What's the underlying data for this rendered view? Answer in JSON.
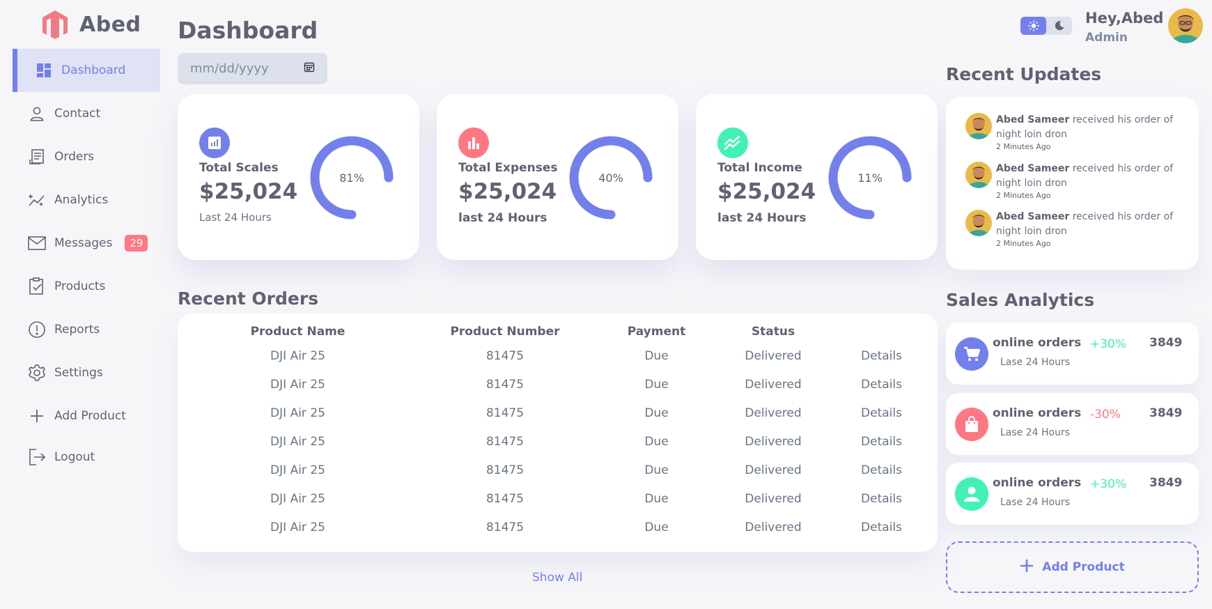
{
  "brand": {
    "name": "Abed"
  },
  "sidebar": {
    "items": [
      {
        "label": "Dashboard"
      },
      {
        "label": "Contact"
      },
      {
        "label": "Orders"
      },
      {
        "label": "Analytics"
      },
      {
        "label": "Messages",
        "badge": "29"
      },
      {
        "label": "Products"
      },
      {
        "label": "Reports"
      },
      {
        "label": "Settings"
      },
      {
        "label": "Add Product"
      },
      {
        "label": "Logout"
      }
    ]
  },
  "main": {
    "title": "Dashboard",
    "date_placeholder": "mm/dd/yyyy",
    "cards": [
      {
        "label": "Total Scales",
        "value": "$25,024",
        "sub": "Last 24 Hours",
        "percent": "81%",
        "icon": "bar-chart-icon",
        "color": "#7380ec"
      },
      {
        "label": "Total Expenses",
        "value": "$25,024",
        "sub": "last 24 Hours",
        "percent": "40%",
        "icon": "bar-graph-icon",
        "color": "#ff7782"
      },
      {
        "label": "Total Income",
        "value": "$25,024",
        "sub": "last 24 Hours",
        "percent": "11%",
        "icon": "trend-icon",
        "color": "#41f1b6"
      }
    ],
    "recent_orders": {
      "title": "Recent Orders",
      "headers": [
        "Product Name",
        "Product Number",
        "Payment",
        "Status",
        ""
      ],
      "rows": [
        {
          "name": "DJI Air 25",
          "number": "81475",
          "payment": "Due",
          "status": "Delivered",
          "status_color": "orange",
          "action": "Details"
        },
        {
          "name": "DJI Air 25",
          "number": "81475",
          "payment": "Due",
          "status": "Delivered",
          "status_color": "gray",
          "action": "Details"
        },
        {
          "name": "DJI Air 25",
          "number": "81475",
          "payment": "Due",
          "status": "Delivered",
          "status_color": "red",
          "action": "Details"
        },
        {
          "name": "DJI Air 25",
          "number": "81475",
          "payment": "Due",
          "status": "Delivered",
          "status_color": "orange",
          "action": "Details"
        },
        {
          "name": "DJI Air 25",
          "number": "81475",
          "payment": "Due",
          "status": "Delivered",
          "status_color": "gray",
          "action": "Details"
        },
        {
          "name": "DJI Air 25",
          "number": "81475",
          "payment": "Due",
          "status": "Delivered",
          "status_color": "red",
          "action": "Details"
        },
        {
          "name": "DJI Air 25",
          "number": "81475",
          "payment": "Due",
          "status": "Delivered",
          "status_color": "orange",
          "action": "Details"
        }
      ],
      "show_all": "Show All"
    }
  },
  "header": {
    "greeting": "Hey,Abed",
    "role": "Admin"
  },
  "recent_updates": {
    "title": "Recent Updates",
    "items": [
      {
        "name": "Abed Sameer",
        "text": " received his order of night loin dron",
        "time": "2 Minutes Ago"
      },
      {
        "name": "Abed Sameer",
        "text": " received his order of night loin dron",
        "time": "2 Minutes Ago"
      },
      {
        "name": "Abed Sameer",
        "text": " received his order of night loin dron",
        "time": "2 Minutes Ago"
      }
    ]
  },
  "sales_analytics": {
    "title": "Sales Analytics",
    "items": [
      {
        "name": "online orders",
        "sub": "Lase 24 Hours",
        "pct": "+30%",
        "value": "3849",
        "icon": "cart-icon",
        "color": "#7380ec"
      },
      {
        "name": "online orders",
        "sub": "Lase 24 Hours",
        "pct": "-30%",
        "value": "3849",
        "icon": "shopping-bag-icon",
        "color": "#ff7782"
      },
      {
        "name": "online orders",
        "sub": "Lase 24 Hours",
        "pct": "+30%",
        "value": "3849",
        "icon": "person-icon",
        "color": "#41f1b6"
      }
    ],
    "add_label": "Add Product"
  }
}
